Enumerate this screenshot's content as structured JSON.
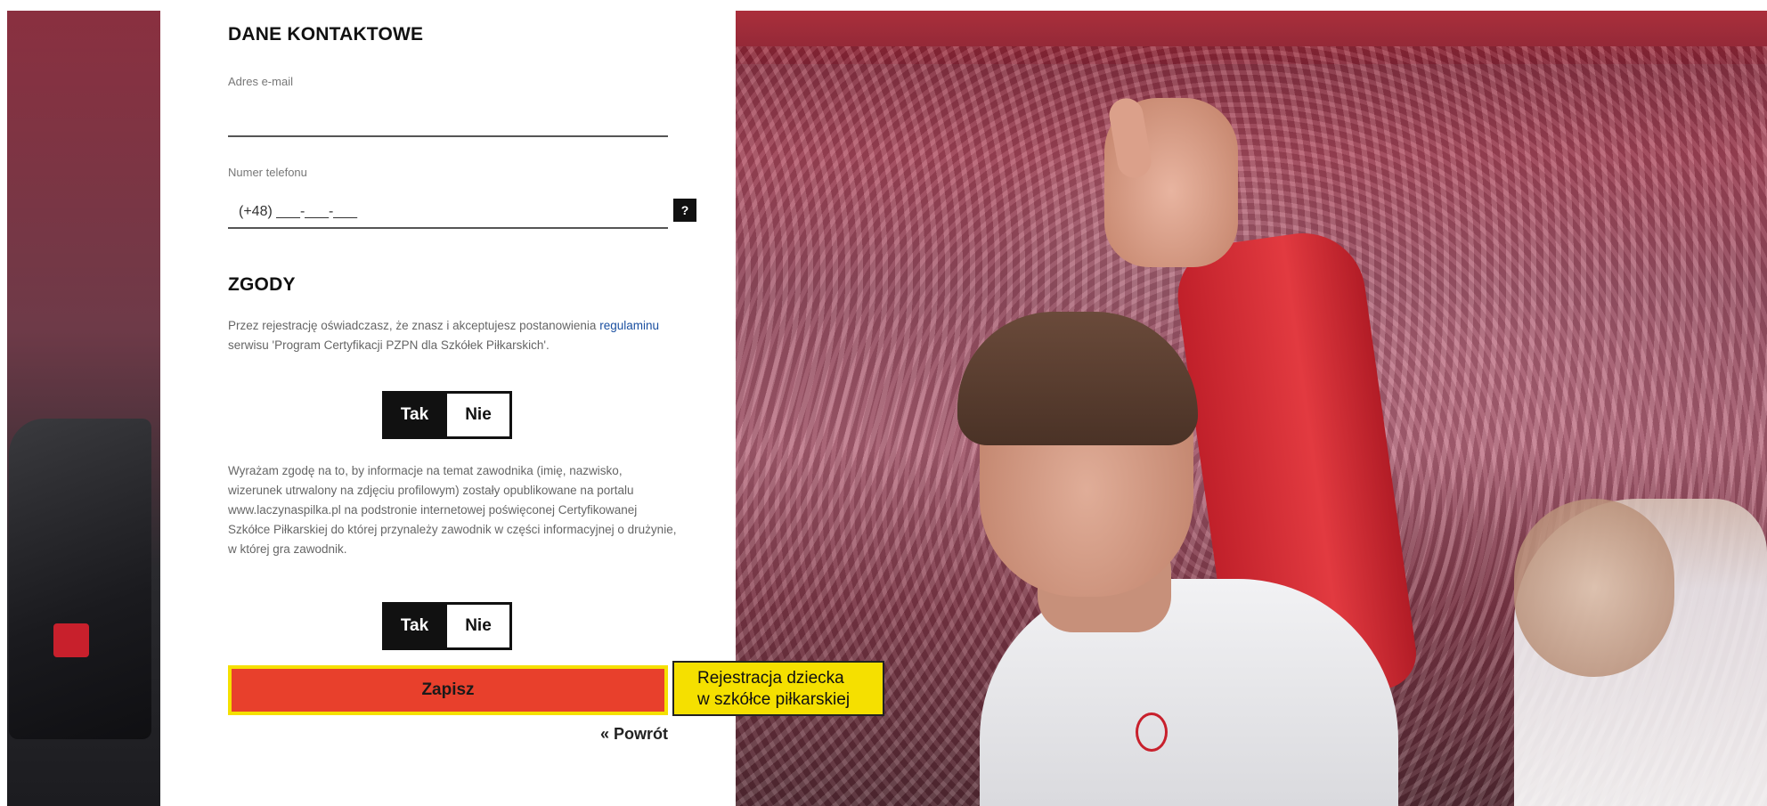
{
  "contact": {
    "title": "DANE KONTAKTOWE",
    "email_label": "Adres e-mail",
    "email_value": "",
    "phone_label": "Numer telefonu",
    "phone_placeholder": "(+48) ___-___-___",
    "help_label": "?"
  },
  "consents": {
    "title": "ZGODY",
    "consent1": {
      "text_before": "Przez rejestrację oświadczasz, że znasz i akceptujesz postanowienia ",
      "link_text": "regulaminu",
      "text_after": " serwisu 'Program Certyfikacji PZPN dla Szkółek Piłkarskich'.",
      "yes": "Tak",
      "no": "Nie"
    },
    "consent2": {
      "text": "Wyrażam zgodę na to, by informacje na temat zawodnika (imię, nazwisko, wizerunek utrwalony na zdjęciu profilowym) zostały opublikowane na portalu www.laczynaspilka.pl na podstronie internetowej poświęconej Certyfikowanej Szkółce Piłkarskiej do której przynależy zawodnik w części informacyjnej o drużynie, w której gra zawodnik.",
      "yes": "Tak",
      "no": "Nie"
    }
  },
  "actions": {
    "submit": "Zapisz",
    "back": "« Powrót"
  },
  "callout": {
    "line1": "Rejestracja dziecka",
    "line2": "w szkółce piłkarskiej"
  },
  "colors": {
    "submit_bg": "#e8402c",
    "submit_border": "#f5e000",
    "callout_bg": "#f5e000",
    "link": "#1a4fa0"
  }
}
